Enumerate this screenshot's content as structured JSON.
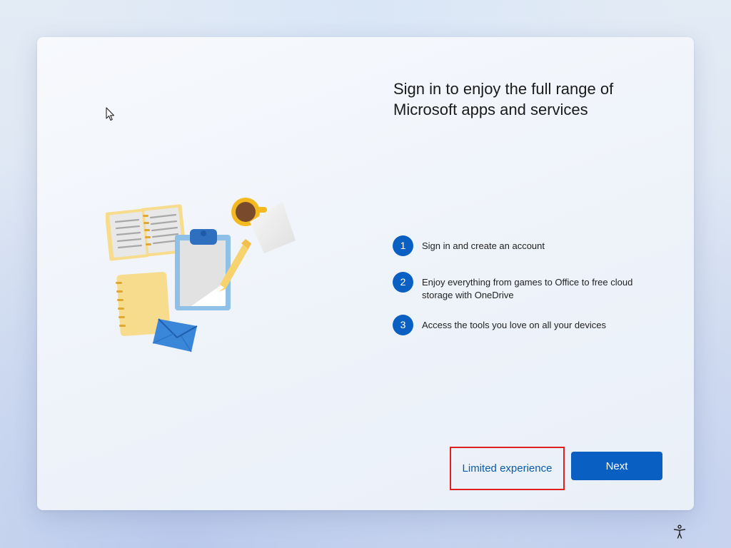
{
  "dialog": {
    "title": "Sign in to enjoy the full range of Microsoft apps and services",
    "steps": [
      {
        "number": "1",
        "text": "Sign in and create an account"
      },
      {
        "number": "2",
        "text": "Enjoy everything from games to Office to free cloud storage with OneDrive"
      },
      {
        "number": "3",
        "text": "Access the tools you love on all your devices"
      }
    ],
    "limited_label": "Limited experience",
    "next_label": "Next",
    "illustration_icon": "notebook-clipboard-coffee-envelope-illustration"
  },
  "footer": {
    "accessibility_icon": "accessibility-icon"
  },
  "colors": {
    "accent": "#0a5fc2",
    "link": "#0a5aa8",
    "highlight_border": "#e02020"
  }
}
